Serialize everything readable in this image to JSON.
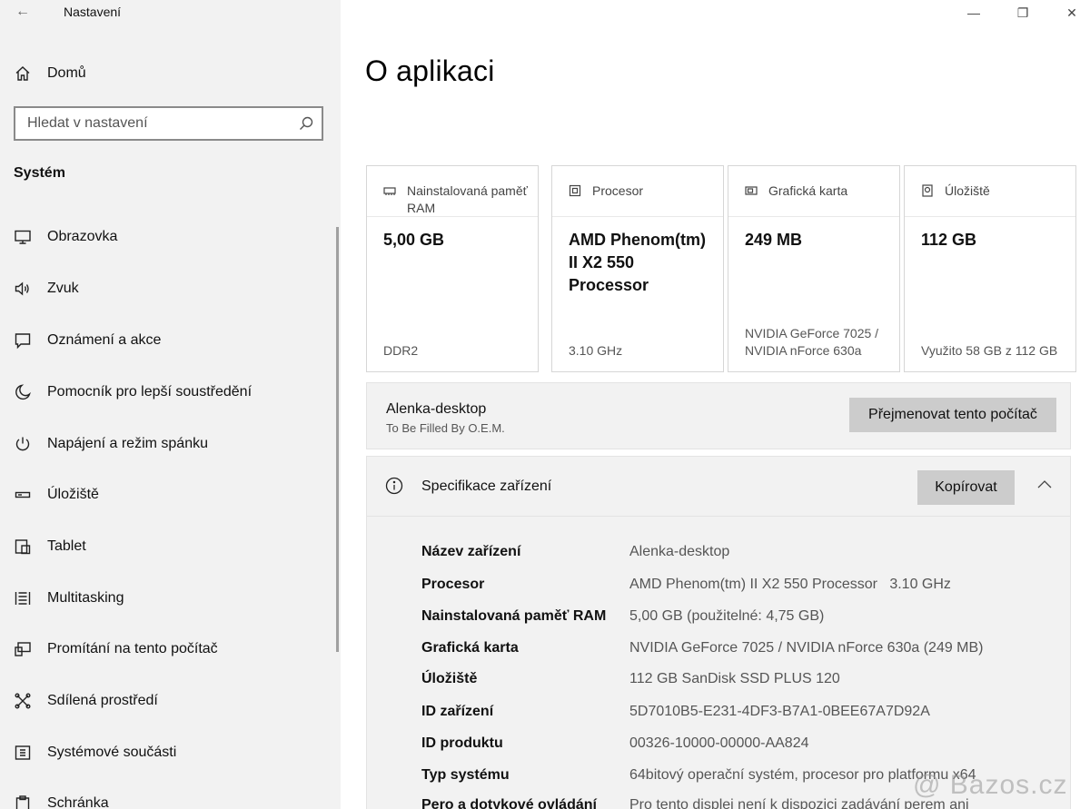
{
  "window": {
    "title": "Nastavení",
    "minimize": "—",
    "maximize": "❐",
    "close": "✕"
  },
  "sidebar": {
    "home_label": "Domů",
    "search_placeholder": "Hledat v nastavení",
    "section_label": "Systém",
    "items": [
      {
        "label": "Obrazovka",
        "icon": "monitor-icon"
      },
      {
        "label": "Zvuk",
        "icon": "speaker-icon"
      },
      {
        "label": "Oznámení a akce",
        "icon": "notification-icon"
      },
      {
        "label": "Pomocník pro lepší soustředění",
        "icon": "moon-icon"
      },
      {
        "label": "Napájení a režim spánku",
        "icon": "power-icon"
      },
      {
        "label": "Úložiště",
        "icon": "storage-icon"
      },
      {
        "label": "Tablet",
        "icon": "tablet-icon"
      },
      {
        "label": "Multitasking",
        "icon": "multitasking-icon"
      },
      {
        "label": "Promítání na tento počítač",
        "icon": "projecting-icon"
      },
      {
        "label": "Sdílená prostředí",
        "icon": "shared-experiences-icon"
      },
      {
        "label": "Systémové součásti",
        "icon": "system-components-icon"
      },
      {
        "label": "Schránka",
        "icon": "clipboard-icon"
      }
    ]
  },
  "main": {
    "page_title": "O aplikaci",
    "cards": [
      {
        "title": "Nainstalovaná paměť RAM",
        "value": "5,00 GB",
        "sub": "DDR2",
        "icon": "ram-icon"
      },
      {
        "title": "Procesor",
        "value": "AMD Phenom(tm) II X2 550 Processor",
        "sub": "3.10 GHz",
        "icon": "processor-icon"
      },
      {
        "title": "Grafická karta",
        "value": "249 MB",
        "sub": "NVIDIA GeForce 7025 / NVIDIA nForce 630a",
        "icon": "graphics-card-icon"
      },
      {
        "title": "Úložiště",
        "value": "112 GB",
        "sub": "Využito 58 GB z 112 GB",
        "icon": "drive-icon"
      }
    ],
    "pc": {
      "name": "Alenka-desktop",
      "maker": "To Be Filled By O.E.M.",
      "rename_label": "Přejmenovat tento počítač"
    },
    "spec": {
      "title": "Specifikace zařízení",
      "copy_label": "Kopírovat",
      "rows": [
        {
          "key": "Název zařízení",
          "value": "Alenka-desktop"
        },
        {
          "key": "Procesor",
          "value": "AMD Phenom(tm) II X2 550 Processor   3.10 GHz"
        },
        {
          "key": "Nainstalovaná paměť RAM",
          "value": "5,00 GB (použitelné: 4,75 GB)"
        },
        {
          "key": "Grafická karta",
          "value": "NVIDIA GeForce 7025 / NVIDIA nForce 630a (249 MB)"
        },
        {
          "key": "Úložiště",
          "value": "112 GB SanDisk SSD PLUS 120"
        },
        {
          "key": "ID zařízení",
          "value": "5D7010B5-E231-4DF3-B7A1-0BEE67A7D92A"
        },
        {
          "key": "ID produktu",
          "value": "00326-10000-00000-AA824"
        },
        {
          "key": "Typ systému",
          "value": "64bitový operační systém, procesor pro platformu x64"
        },
        {
          "key": "Pero a dotykové ovládání",
          "value": "Pro tento displej není k dispozici zadávání perem ani"
        }
      ]
    }
  },
  "watermark": "@ Bazos.cz"
}
